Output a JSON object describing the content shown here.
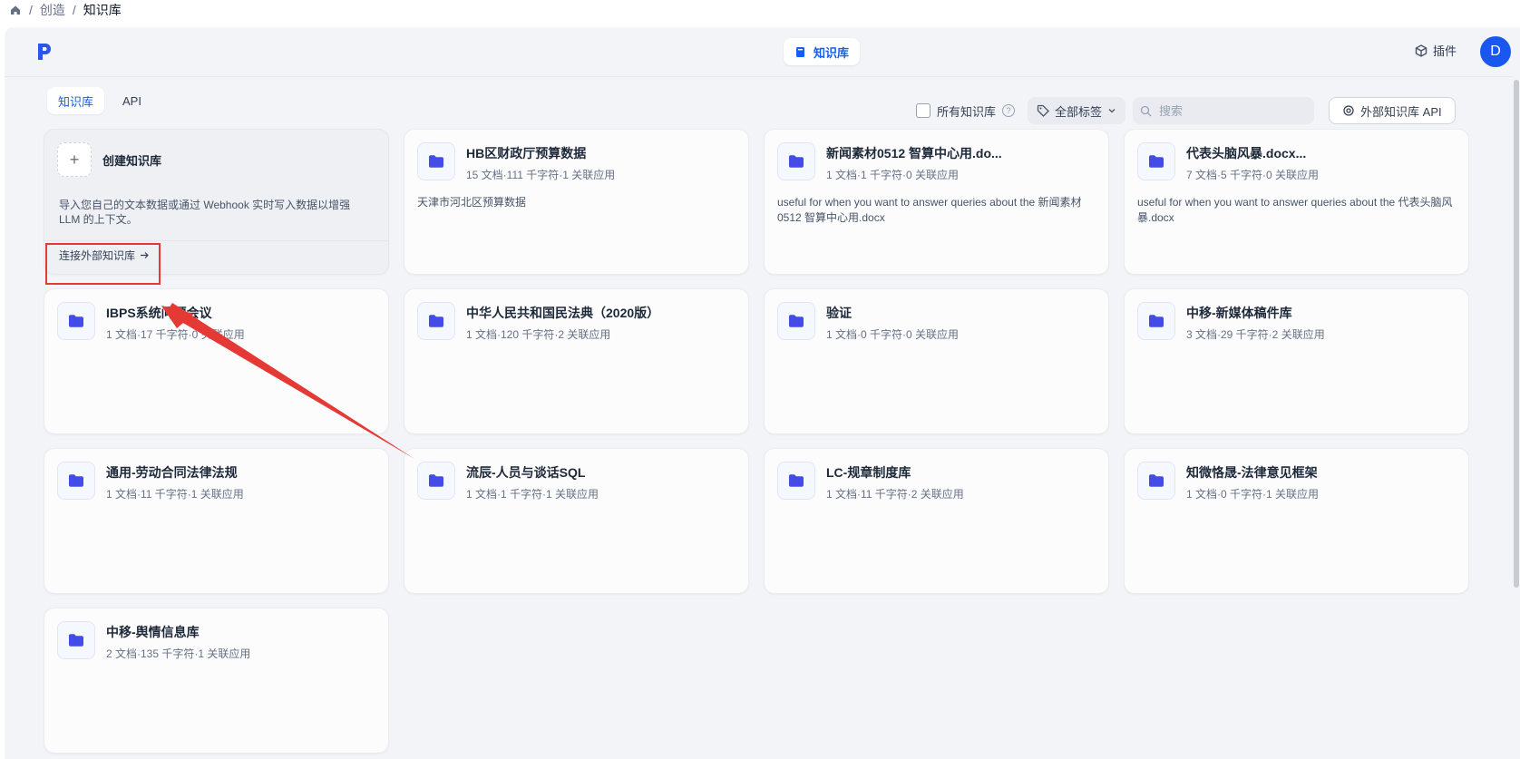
{
  "breadcrumb": {
    "items": [
      "创造",
      "知识库"
    ]
  },
  "header": {
    "center_label": "知识库",
    "plugin_label": "插件",
    "avatar_initial": "D"
  },
  "tabs": [
    {
      "label": "知识库",
      "active": true
    },
    {
      "label": "API",
      "active": false
    }
  ],
  "filters": {
    "all_label": "所有知识库",
    "tags_label": "全部标签",
    "search_placeholder": "搜索",
    "external_api_label": "外部知识库 API"
  },
  "create_card": {
    "title": "创建知识库",
    "description": "导入您自己的文本数据或通过 Webhook 实时写入数据以增强 LLM 的上下文。",
    "link_label": "连接外部知识库"
  },
  "knowledge_bases": [
    {
      "title": "HB区财政厅预算数据",
      "meta": "15 文档·111 千字符·1 关联应用",
      "description": "天津市河北区预算数据"
    },
    {
      "title": "新闻素材0512 智算中心用.do...",
      "meta": "1 文档·1 千字符·0 关联应用",
      "description": "useful for when you want to answer queries about the 新闻素材0512 智算中心用.docx"
    },
    {
      "title": "代表头脑风暴.docx...",
      "meta": "7 文档·5 千字符·0 关联应用",
      "description": "useful for when you want to answer queries about the 代表头脑风暴.docx"
    },
    {
      "title": "IBPS系统问题会议",
      "meta": "1 文档·17 千字符·0 关联应用",
      "description": ""
    },
    {
      "title": "中华人民共和国民法典（2020版）",
      "meta": "1 文档·120 千字符·2 关联应用",
      "description": ""
    },
    {
      "title": "验证",
      "meta": "1 文档·0 千字符·0 关联应用",
      "description": ""
    },
    {
      "title": "中移-新媒体稿件库",
      "meta": "3 文档·29 千字符·2 关联应用",
      "description": ""
    },
    {
      "title": "通用-劳动合同法律法规",
      "meta": "1 文档·11 千字符·1 关联应用",
      "description": ""
    },
    {
      "title": "流辰-人员与谈话SQL",
      "meta": "1 文档·1 千字符·1 关联应用",
      "description": ""
    },
    {
      "title": "LC-规章制度库",
      "meta": "1 文档·11 千字符·2 关联应用",
      "description": ""
    },
    {
      "title": "知微恪晟-法律意见框架",
      "meta": "1 文档·0 千字符·1 关联应用",
      "description": ""
    },
    {
      "title": "中移-舆情信息库",
      "meta": "2 文档·135 千字符·1 关联应用",
      "description": ""
    }
  ],
  "colors": {
    "accent": "#155eef",
    "folder": "#444ce7",
    "annotation": "#e53935"
  },
  "icons": {
    "home": "home-icon",
    "folder": "folder-icon",
    "plugin": "cube-icon",
    "tag": "tag-icon",
    "search": "search-icon"
  }
}
